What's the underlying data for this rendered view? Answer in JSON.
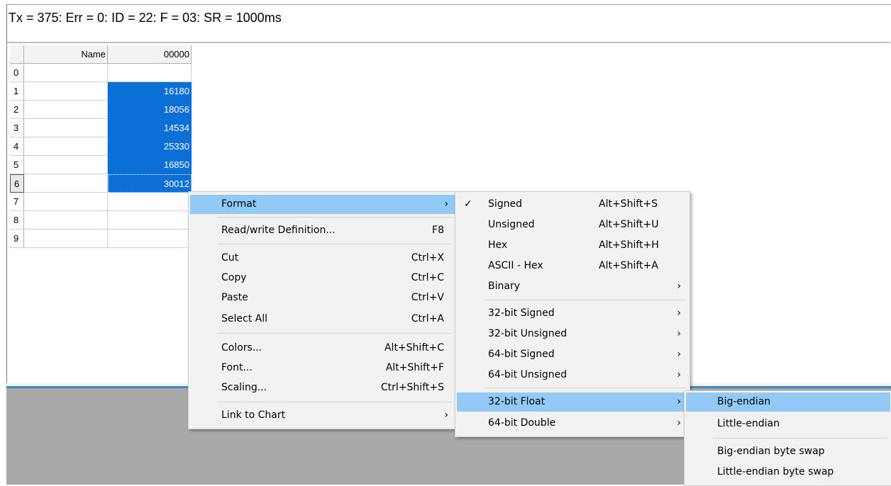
{
  "status": {
    "text": "Tx = 375: Err = 0: ID = 22: F = 03: SR = 1000ms"
  },
  "grid": {
    "header": {
      "name": "Name",
      "col": "00000"
    },
    "rows": [
      {
        "idx": "0",
        "name": "",
        "value": ""
      },
      {
        "idx": "1",
        "name": "",
        "value": "16180"
      },
      {
        "idx": "2",
        "name": "",
        "value": "18056"
      },
      {
        "idx": "3",
        "name": "",
        "value": "14534"
      },
      {
        "idx": "4",
        "name": "",
        "value": "25330"
      },
      {
        "idx": "5",
        "name": "",
        "value": "16850"
      },
      {
        "idx": "6",
        "name": "",
        "value": "30012"
      },
      {
        "idx": "7",
        "name": "",
        "value": ""
      },
      {
        "idx": "8",
        "name": "",
        "value": ""
      },
      {
        "idx": "9",
        "name": "",
        "value": ""
      }
    ]
  },
  "context_menu": {
    "items": [
      {
        "label": "Format",
        "shortcut": "",
        "submenu": true
      },
      {
        "label": "Read/write Definition...",
        "shortcut": "F8"
      },
      {
        "label": "Cut",
        "shortcut": "Ctrl+X"
      },
      {
        "label": "Copy",
        "shortcut": "Ctrl+C"
      },
      {
        "label": "Paste",
        "shortcut": "Ctrl+V"
      },
      {
        "label": "Select All",
        "shortcut": "Ctrl+A"
      },
      {
        "label": "Colors...",
        "shortcut": "Alt+Shift+C"
      },
      {
        "label": "Font...",
        "shortcut": "Alt+Shift+F"
      },
      {
        "label": "Scaling...",
        "shortcut": "Ctrl+Shift+S"
      },
      {
        "label": "Link to Chart",
        "shortcut": "",
        "submenu": true
      }
    ]
  },
  "format_menu": {
    "items": [
      {
        "label": "Signed",
        "shortcut": "Alt+Shift+S",
        "checked": true
      },
      {
        "label": "Unsigned",
        "shortcut": "Alt+Shift+U"
      },
      {
        "label": "Hex",
        "shortcut": "Alt+Shift+H"
      },
      {
        "label": "ASCII - Hex",
        "shortcut": "Alt+Shift+A"
      },
      {
        "label": "Binary",
        "submenu": true
      },
      {
        "label": "32-bit Signed",
        "submenu": true
      },
      {
        "label": "32-bit Unsigned",
        "submenu": true
      },
      {
        "label": "64-bit Signed",
        "submenu": true
      },
      {
        "label": "64-bit Unsigned",
        "submenu": true
      },
      {
        "label": "32-bit Float",
        "submenu": true
      },
      {
        "label": "64-bit Double",
        "submenu": true
      }
    ]
  },
  "float_menu": {
    "items": [
      {
        "label": "Big-endian"
      },
      {
        "label": "Little-endian"
      },
      {
        "label": "Big-endian byte swap"
      },
      {
        "label": "Little-endian byte swap"
      }
    ]
  },
  "icons": {
    "check": "✓",
    "arrow": "›"
  },
  "colors": {
    "selection": "#0a6fd6",
    "menu_highlight": "#91c9f7"
  }
}
